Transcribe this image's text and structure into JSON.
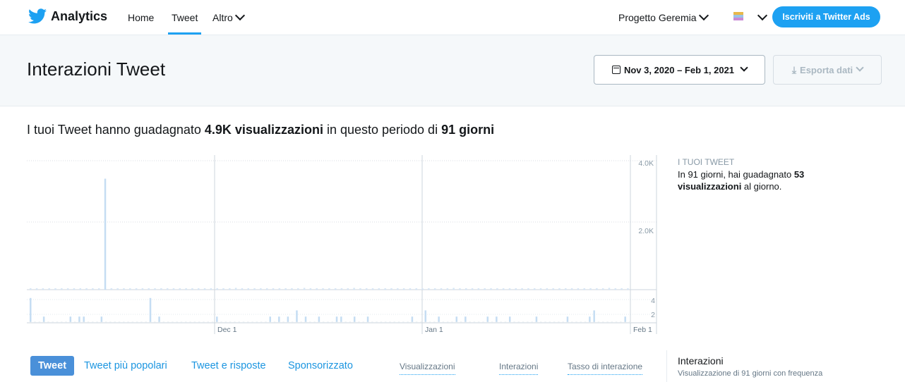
{
  "nav": {
    "brand": "Analytics",
    "items": [
      "Home",
      "Tweet",
      "Altro"
    ],
    "account": "Progetto Geremia",
    "ads_button": "Iscriviti a Twitter Ads"
  },
  "header": {
    "title": "Interazioni Tweet",
    "date_range": "Nov 3, 2020 – Feb 1, 2021",
    "export_label": "Esporta dati"
  },
  "summary": {
    "prefix": "I tuoi Tweet hanno guadagnato ",
    "impressions": "4.9K visualizzazioni",
    "middle": " in questo periodo di ",
    "days": "91 giorni"
  },
  "stats": {
    "heading": "I TUOI TWEET",
    "line1": "In 91 giorni, hai guadagnato ",
    "daily": "53",
    "line2_bold": "visualizzazioni",
    "line2_rest": " al giorno."
  },
  "chart_data": {
    "type": "bar",
    "x_tick_labels": [
      "Dec 1",
      "Jan 1",
      "Feb 1"
    ],
    "impressions_yticks": [
      "4.0K",
      "2.0K"
    ],
    "impressions_ylim": [
      0,
      4300
    ],
    "impressions_values": [
      40,
      40,
      40,
      40,
      40,
      40,
      40,
      40,
      40,
      40,
      40,
      40,
      3700,
      40,
      40,
      40,
      40,
      40,
      40,
      40,
      40,
      40,
      40,
      40,
      40,
      40,
      40,
      40,
      40,
      40,
      40,
      40,
      40,
      60,
      40,
      40,
      40,
      40,
      40,
      40,
      40,
      40,
      40,
      40,
      60,
      40,
      40,
      40,
      40,
      40,
      40,
      40,
      60,
      40,
      40,
      40,
      40,
      40,
      40,
      40,
      40,
      40,
      40,
      40,
      40,
      40,
      40,
      40,
      60,
      40,
      40,
      40,
      40,
      40,
      40,
      40,
      40,
      40,
      40,
      40,
      40,
      40,
      40,
      40,
      40,
      40,
      40,
      40,
      40,
      40,
      40,
      40,
      40,
      60,
      40,
      40,
      40
    ],
    "interactions_yticks": [
      "4",
      "2"
    ],
    "interactions_ylim": [
      0,
      5
    ],
    "interactions_values": [
      4,
      0,
      0,
      1,
      0,
      0,
      0,
      0,
      0,
      1,
      0,
      1,
      1,
      0,
      0,
      0,
      1,
      0,
      0,
      0,
      0,
      0,
      0,
      0,
      0,
      0,
      0,
      4,
      0,
      1,
      0,
      0,
      0,
      0,
      0,
      0,
      0,
      0,
      0,
      0,
      0,
      0,
      1,
      0,
      0,
      0,
      0,
      0,
      0,
      0,
      0,
      0,
      0,
      0,
      1,
      0,
      1,
      0,
      1,
      0,
      2,
      0,
      1,
      0,
      0,
      1,
      0,
      0,
      0,
      1,
      1,
      0,
      0,
      1,
      0,
      0,
      1,
      0,
      0,
      0,
      0,
      0,
      0,
      0,
      0,
      0,
      1,
      0,
      0,
      2,
      0,
      0,
      1,
      0,
      0,
      0,
      1,
      0,
      1,
      0,
      0,
      0,
      0,
      1,
      0,
      1,
      0,
      0,
      1,
      0,
      0,
      0,
      0,
      0,
      1,
      0,
      0,
      0,
      0,
      0,
      0,
      1,
      0,
      0,
      0,
      0,
      1,
      2,
      0,
      0,
      0,
      0,
      0,
      0,
      1,
      0
    ]
  },
  "tabs": [
    "Tweet",
    "Tweet più popolari",
    "Tweet e risposte",
    "Sponsorizzato"
  ],
  "metrics": [
    "Visualizzazioni",
    "Interazioni",
    "Tasso di interazione"
  ],
  "interactions_panel": {
    "title": "Interazioni",
    "subtitle": "Visualizzazione di 91 giorni con frequenza"
  },
  "colors": {
    "accent": "#1da1f2",
    "bar": "#c5ddf3",
    "bar_low": "#d7e6f5"
  }
}
